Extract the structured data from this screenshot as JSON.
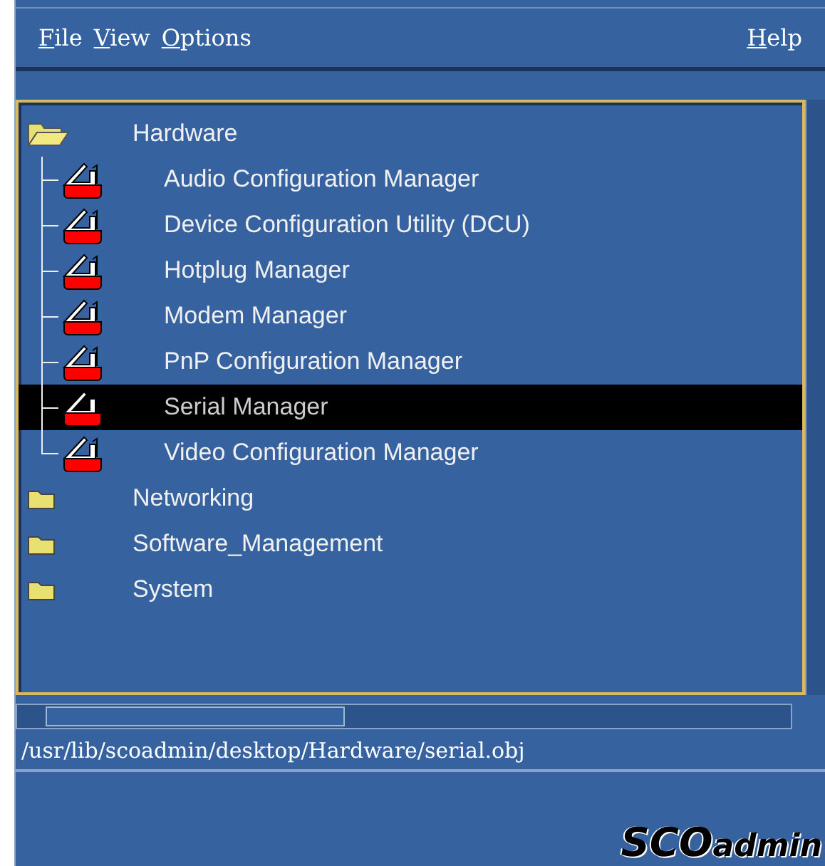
{
  "menu": {
    "left": [
      {
        "label": "File"
      },
      {
        "label": "View"
      },
      {
        "label": "Options"
      }
    ],
    "right": [
      {
        "label": "Help"
      }
    ]
  },
  "tree": [
    {
      "label": "Hardware",
      "kind": "folder",
      "expanded": true,
      "selected": false,
      "children": [
        {
          "label": "Audio Configuration Manager",
          "kind": "app",
          "selected": false
        },
        {
          "label": "Device Configuration Utility (DCU)",
          "kind": "app",
          "selected": false
        },
        {
          "label": "Hotplug Manager",
          "kind": "app",
          "selected": false
        },
        {
          "label": "Modem Manager",
          "kind": "app",
          "selected": false
        },
        {
          "label": "PnP Configuration Manager",
          "kind": "app",
          "selected": false
        },
        {
          "label": "Serial Manager",
          "kind": "app",
          "selected": true
        },
        {
          "label": "Video Configuration Manager",
          "kind": "app",
          "selected": false
        }
      ]
    },
    {
      "label": "Networking",
      "kind": "folder",
      "expanded": false,
      "selected": false
    },
    {
      "label": "Software_Management",
      "kind": "folder",
      "expanded": false,
      "selected": false
    },
    {
      "label": "System",
      "kind": "folder",
      "expanded": false,
      "selected": false
    }
  ],
  "path": "/usr/lib/scoadmin/desktop/Hardware/serial.obj",
  "logo": "**SCO**admin"
}
